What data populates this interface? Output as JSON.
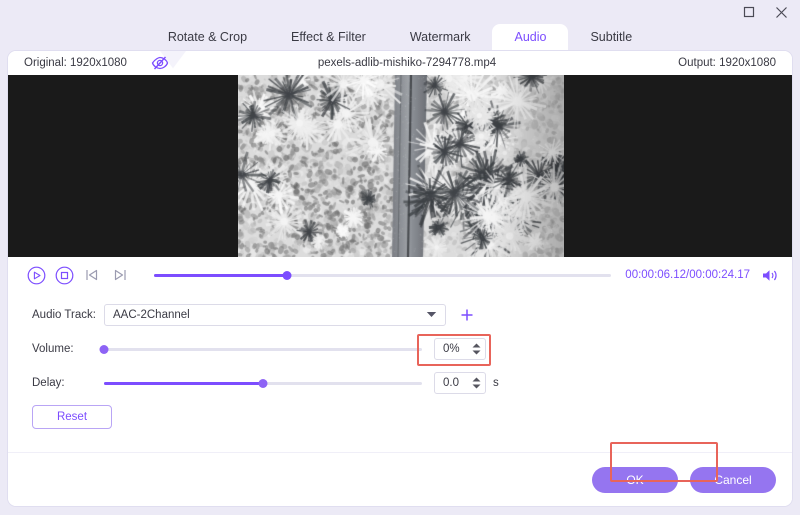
{
  "window": {
    "maximize_label": "maximize-restore",
    "close_label": "close"
  },
  "tabs": [
    {
      "label": "Rotate & Crop",
      "active": false
    },
    {
      "label": "Effect & Filter",
      "active": false
    },
    {
      "label": "Watermark",
      "active": false
    },
    {
      "label": "Audio",
      "active": true
    },
    {
      "label": "Subtitle",
      "active": false
    }
  ],
  "info_bar": {
    "original": "Original: 1920x1080",
    "filename": "pexels-adlib-mishiko-7294778.mp4",
    "output": "Output: 1920x1080",
    "eye_icon": "eye-off-icon"
  },
  "player": {
    "play_icon": "play-circle-icon",
    "stop_icon": "stop-circle-icon",
    "prev_icon": "previous-frame-icon",
    "next_icon": "next-frame-icon",
    "current_time": "00:00:06.12",
    "separator": "/",
    "total_time": "00:00:24.17",
    "timecode": "00:00:06.12/00:00:24.17",
    "seek_percent": 29,
    "volume_icon": "speaker-icon"
  },
  "settings": {
    "audio_track_label": "Audio Track:",
    "audio_track_value": "AAC-2Channel",
    "add_track_icon": "plus-icon",
    "dropdown_icon": "chevron-down-icon",
    "volume_label": "Volume:",
    "volume_value": "0%",
    "volume_percent": 0,
    "delay_label": "Delay:",
    "delay_value": "0.0",
    "delay_unit": "s",
    "delay_percent": 50,
    "reset_label": "Reset"
  },
  "footer": {
    "ok_label": "OK",
    "cancel_label": "Cancel"
  },
  "colors": {
    "accent": "#7c4dff",
    "button": "#9575f0",
    "window_bg": "#eceaf6",
    "panel_bg": "#ffffff",
    "highlight": "#e8645a",
    "stage_bg": "#1a1a1a"
  },
  "highlights": [
    {
      "name": "volume-value-highlight"
    },
    {
      "name": "ok-button-highlight"
    }
  ]
}
